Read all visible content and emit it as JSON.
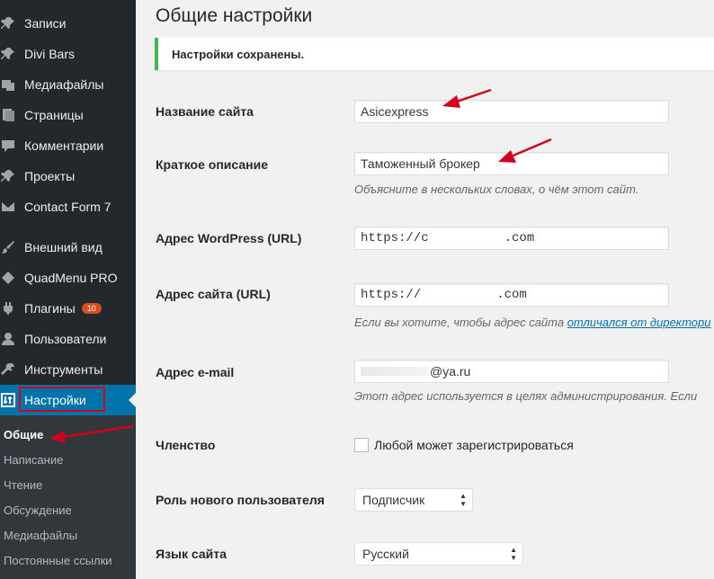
{
  "sidebar": {
    "items": [
      {
        "label": "Записи",
        "icon": "pin-icon"
      },
      {
        "label": "Divi Bars",
        "icon": "pin-icon"
      },
      {
        "label": "Медиафайлы",
        "icon": "media-icon"
      },
      {
        "label": "Страницы",
        "icon": "pages-icon"
      },
      {
        "label": "Комментарии",
        "icon": "comments-icon"
      },
      {
        "label": "Проекты",
        "icon": "pin-icon"
      },
      {
        "label": "Contact Form 7",
        "icon": "mail-icon"
      },
      {
        "label": "Внешний вид",
        "icon": "brush-icon"
      },
      {
        "label": "QuadMenu PRO",
        "icon": "diamond-icon"
      },
      {
        "label": "Плагины",
        "icon": "plugin-icon",
        "badge": "10"
      },
      {
        "label": "Пользователи",
        "icon": "user-icon"
      },
      {
        "label": "Инструменты",
        "icon": "wrench-icon"
      },
      {
        "label": "Настройки",
        "icon": "settings-icon",
        "active": true
      }
    ],
    "submenu": [
      {
        "label": "Общие",
        "current": true
      },
      {
        "label": "Написание"
      },
      {
        "label": "Чтение"
      },
      {
        "label": "Обсуждение"
      },
      {
        "label": "Медиафайлы"
      },
      {
        "label": "Постоянные ссылки"
      }
    ]
  },
  "main": {
    "title": "Общие настройки",
    "notice": "Настройки сохранены.",
    "site_title": {
      "label": "Название сайта",
      "value": "Asicexpress"
    },
    "tagline": {
      "label": "Краткое описание",
      "value": "Таможенный брокер",
      "description": "Объясните в нескольких словах, о чём этот сайт."
    },
    "wp_url": {
      "label": "Адрес WordPress (URL)",
      "value": "https://c          .com"
    },
    "site_url": {
      "label": "Адрес сайта (URL)",
      "value": "https://          .com",
      "description_prefix": "Если вы хотите, чтобы адрес сайта ",
      "description_link": "отличался от директори"
    },
    "email": {
      "label": "Адрес e-mail",
      "value": "@ya.ru",
      "description": "Этот адрес используется в целях администрирования. Если"
    },
    "membership": {
      "label": "Членство",
      "checkbox_label": "Любой может зарегистрироваться",
      "checked": false
    },
    "default_role": {
      "label": "Роль нового пользователя",
      "value": "Подписчик"
    },
    "language": {
      "label": "Язык сайта",
      "value": "Русский"
    }
  },
  "colors": {
    "sidebar_bg": "#23282d",
    "active": "#0073aa",
    "notice_border": "#46b450",
    "annotation": "#d0021b",
    "badge": "#d54e21"
  }
}
